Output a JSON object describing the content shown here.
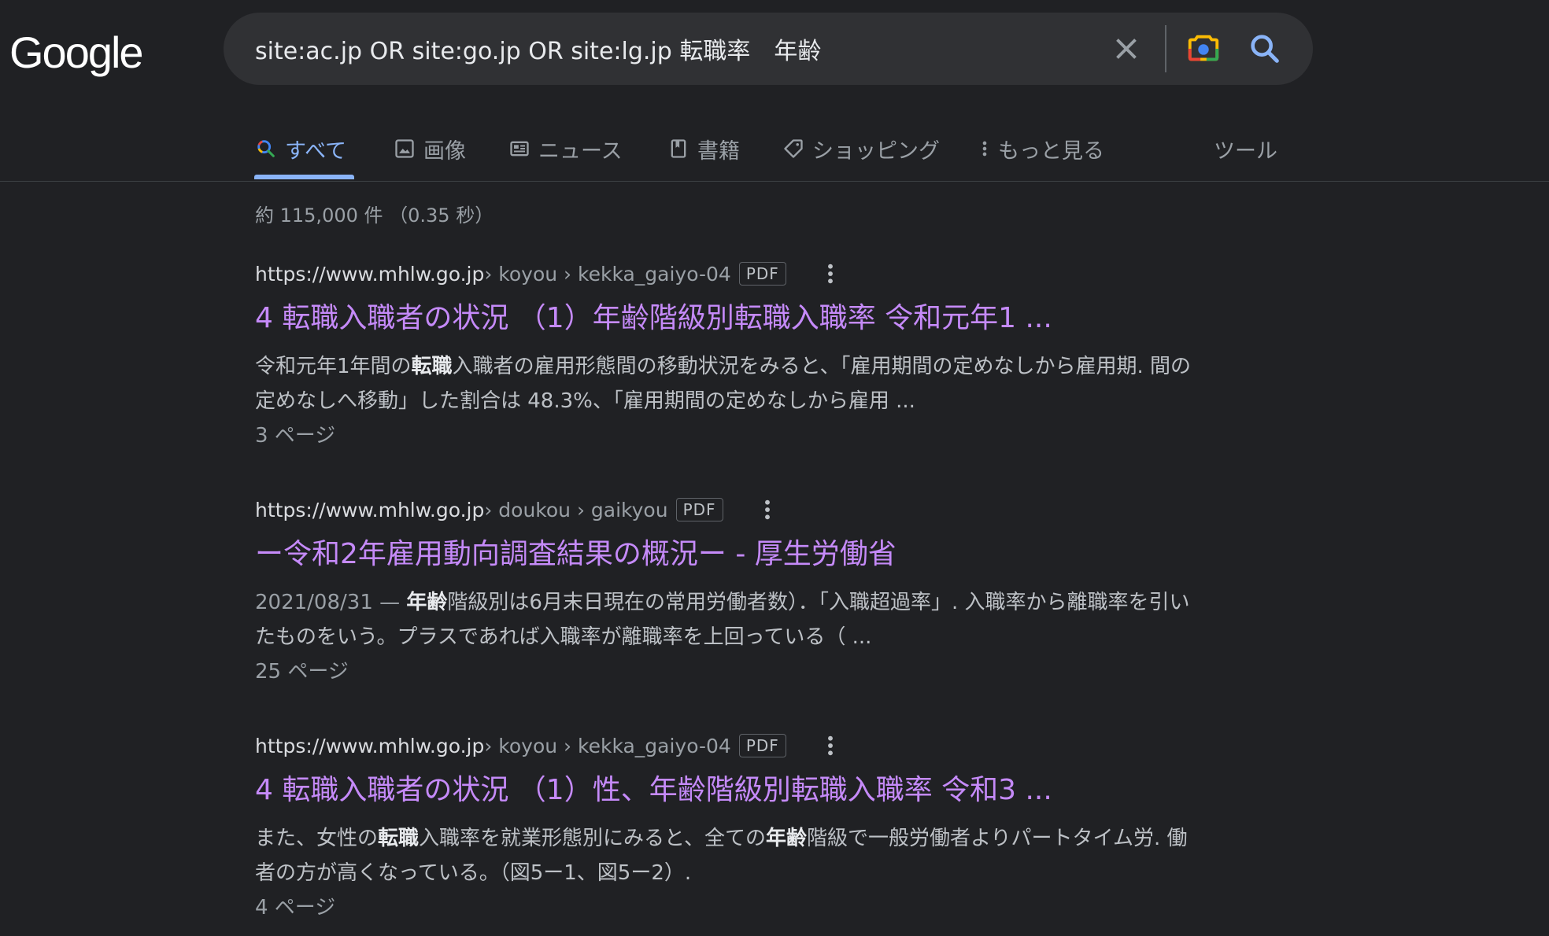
{
  "logo": {
    "text": "Google"
  },
  "search": {
    "query": "site:ac.jp OR site:go.jp OR site:lg.jp 転職率　年齢"
  },
  "tabs": [
    {
      "label": "すべて",
      "icon": "search-icon",
      "active": true
    },
    {
      "label": "画像",
      "icon": "image-icon"
    },
    {
      "label": "ニュース",
      "icon": "news-icon"
    },
    {
      "label": "書籍",
      "icon": "book-icon"
    },
    {
      "label": "ショッピング",
      "icon": "tag-icon"
    },
    {
      "label": "もっと見る",
      "icon": "more-vert-icon"
    }
  ],
  "tools_label": "ツール",
  "stats": "約 115,000 件 （0.35 秒）",
  "results": [
    {
      "domain": "https://www.mhlw.go.jp",
      "path": " › koyou › kekka_gaiyo-04",
      "badge": "PDF",
      "title": "4 転職入職者の状況 （1）年齢階級別転職入職率 令和元年1 ...",
      "snippet": {
        "s1": "令和元年1年間の",
        "b1": "転職",
        "s2": "入職者の雇用形態間の移動状況をみると、「雇用期間の定めなしから雇用期. 間の定めなしへ移動」した割合は 48.3%、「雇用期間の定めなしから雇用 ..."
      },
      "pages": "3 ページ"
    },
    {
      "domain": "https://www.mhlw.go.jp",
      "path": " › doukou › gaikyou",
      "badge": "PDF",
      "title": "ー令和2年雇用動向調査結果の概況ー - 厚生労働省",
      "snippet": {
        "date": "2021/08/31 — ",
        "b1": "年齢",
        "s1": "階級別は6月末日現在の常用労働者数）．「入職超過率」. 入職率から離職率を引いたものをいう。プラスであれば入職率が離職率を上回っている（ ..."
      },
      "pages": "25 ページ"
    },
    {
      "domain": "https://www.mhlw.go.jp",
      "path": " › koyou › kekka_gaiyo-04",
      "badge": "PDF",
      "title": "4 転職入職者の状況 （1）性、年齢階級別転職入職率 令和3 ...",
      "snippet": {
        "s1": "また、女性の",
        "b1": "転職",
        "s2": "入職率を就業形態別にみると、全ての",
        "b2": "年齢",
        "s3": "階級で一般労働者よりパートタイム労. 働者の方が高くなっている。（図5ー1、図5ー2）."
      },
      "pages": "4 ページ"
    }
  ],
  "colors": {
    "background": "#202124",
    "link_visited": "#c58af9",
    "accent": "#8ab4f8"
  }
}
